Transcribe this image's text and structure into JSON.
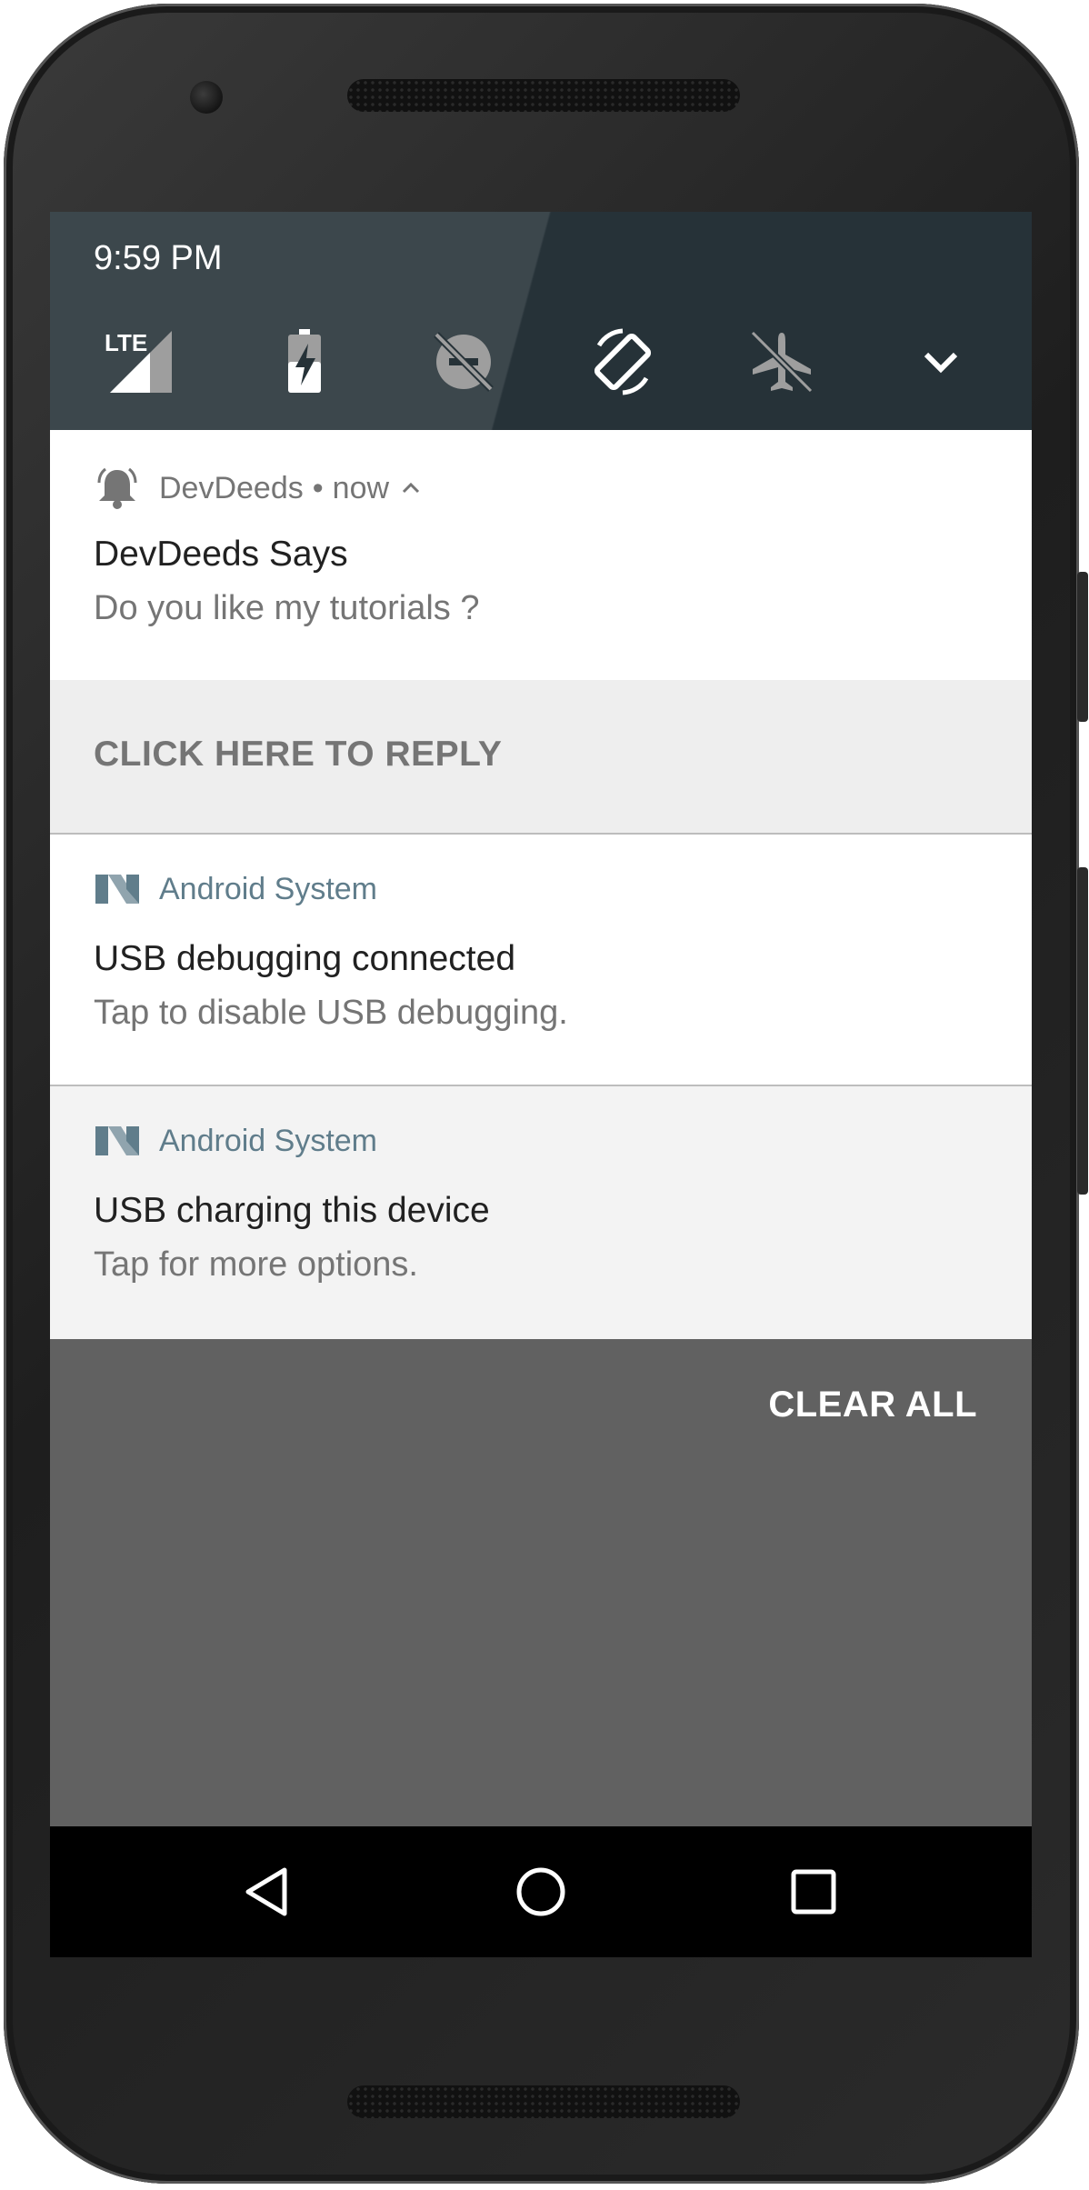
{
  "status_bar": {
    "time": "9:59 PM",
    "network_label": "LTE"
  },
  "quick_settings": [
    {
      "name": "signal-lte-icon"
    },
    {
      "name": "battery-charging-icon"
    },
    {
      "name": "do-not-disturb-off-icon"
    },
    {
      "name": "auto-rotate-icon"
    },
    {
      "name": "airplane-mode-icon"
    },
    {
      "name": "expand-chevron-icon"
    }
  ],
  "notifications": [
    {
      "app": "DevDeeds",
      "time_sep": "•",
      "time": "now",
      "title": "DevDeeds Says",
      "text": "Do you like my tutorials ?",
      "action": "CLICK HERE TO REPLY",
      "icon": "bell-icon"
    },
    {
      "app": "Android System",
      "title": "USB debugging connected",
      "text": "Tap to disable USB debugging.",
      "icon": "android-n-icon"
    },
    {
      "app": "Android System",
      "title": "USB charging this device",
      "text": "Tap for more options.",
      "icon": "android-n-icon"
    }
  ],
  "shade": {
    "clear_all": "CLEAR ALL"
  },
  "nav": [
    "back-icon",
    "home-icon",
    "recents-icon"
  ],
  "colors": {
    "qs_background": "#263238",
    "shade_background": "#616161",
    "app_accent": "#607d8b",
    "reply_background": "#eeeeee"
  }
}
